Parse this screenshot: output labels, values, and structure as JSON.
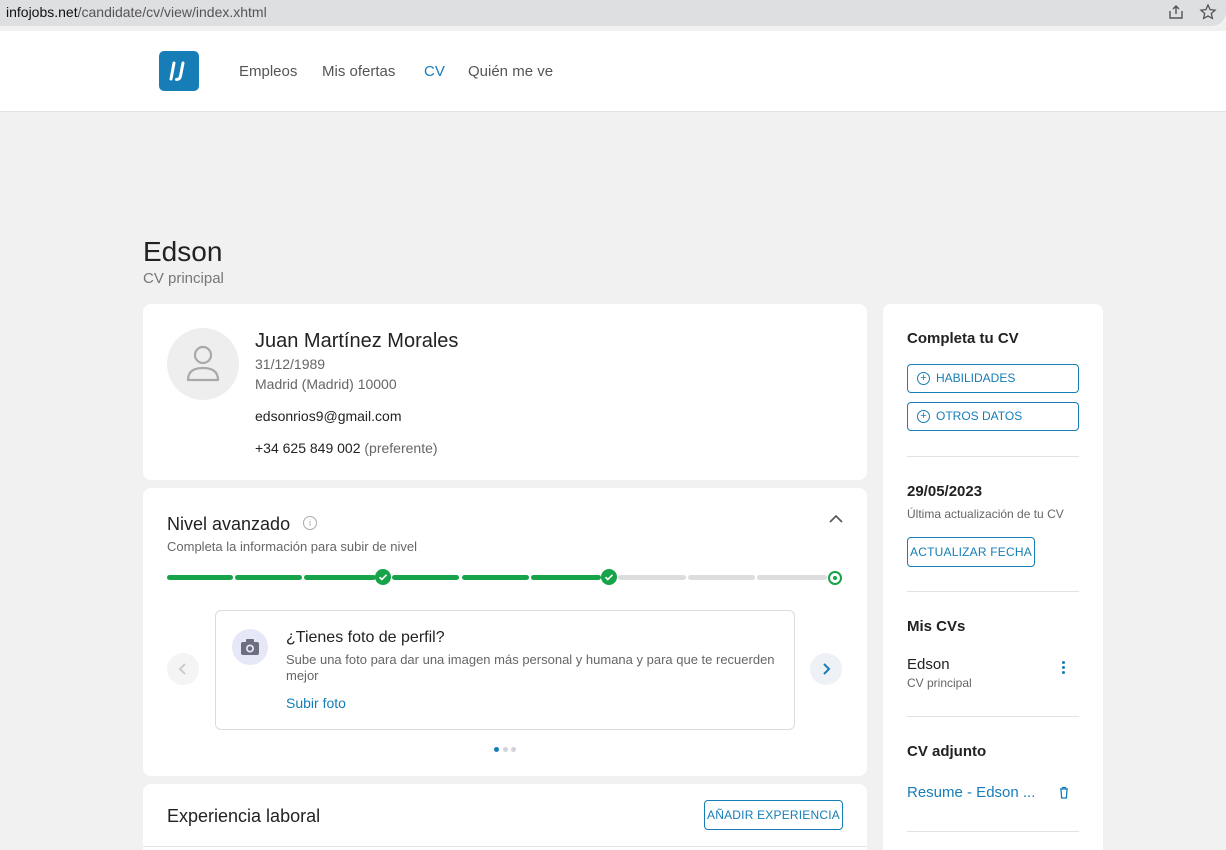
{
  "browser": {
    "url_domain": "infojobs.net",
    "url_path": "/candidate/cv/view/index.xhtml"
  },
  "nav": {
    "items": [
      {
        "label": "Empleos"
      },
      {
        "label": "Mis ofertas"
      },
      {
        "label": "CV"
      },
      {
        "label": "Quién me ve"
      }
    ],
    "active": "CV"
  },
  "header": {
    "title": "Edson",
    "subtitle": "CV principal"
  },
  "profile": {
    "name": "Juan Martínez Morales",
    "birthdate": "31/12/1989",
    "location": "Madrid (Madrid) 10000",
    "email": "edsonrios9@gmail.com",
    "phone": "+34 625 849 002",
    "phone_note": "(preferente)"
  },
  "level": {
    "title": "Nivel avanzado",
    "subtitle": "Completa la información para subir de nivel",
    "progress_completed_segments": 6,
    "progress_total_segments": 9,
    "tip": {
      "title": "¿Tienes foto de perfil?",
      "description": "Sube una foto para dar una imagen más personal y humana y para que te recuerden mejor",
      "link": "Subir foto"
    },
    "carousel_active_index": 0,
    "carousel_total": 3
  },
  "experience": {
    "title": "Experiencia laboral",
    "add_button": "AÑADIR EXPERIENCIA"
  },
  "sidebar": {
    "complete_title": "Completa tu CV",
    "buttons": [
      {
        "label": "HABILIDADES"
      },
      {
        "label": "OTROS DATOS"
      }
    ],
    "update_date": "29/05/2023",
    "update_caption": "Última actualización de tu CV",
    "update_button": "ACTUALIZAR FECHA",
    "mis_cvs_title": "Mis CVs",
    "cv_item": {
      "name": "Edson",
      "subtitle": "CV principal"
    },
    "attached_title": "CV adjunto",
    "attached_file": "Resume - Edson ..."
  },
  "colors": {
    "brand": "#167db7",
    "success": "#16a34a",
    "background": "#f1f1f1"
  }
}
